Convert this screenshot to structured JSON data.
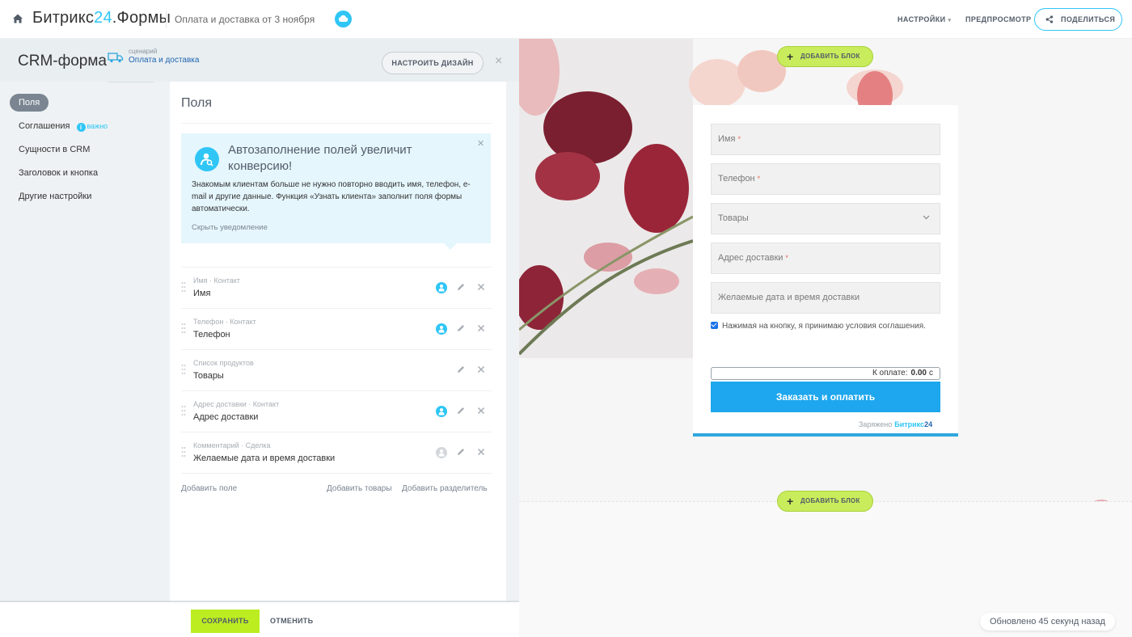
{
  "topbar": {
    "logo_main": "Битрикс",
    "logo_accent": "24",
    "logo_tail": ".Формы",
    "page_title": "Оплата и доставка от 3 ноября",
    "settings_label": "НАСТРОЙКИ",
    "preview_label": "ПРЕДПРОСМОТР",
    "share_label": "ПОДЕЛИТЬСЯ"
  },
  "header": {
    "title": "CRM-форма",
    "scenario_caption": "сценарий",
    "scenario_name": "Оплата и доставка",
    "design_button": "НАСТРОИТЬ ДИЗАЙН"
  },
  "sidebar": {
    "items": [
      {
        "label": "Поля",
        "active": true
      },
      {
        "label": "Соглашения",
        "badge": "важно"
      },
      {
        "label": "Сущности в CRM"
      },
      {
        "label": "Заголовок и кнопка"
      },
      {
        "label": "Другие настройки"
      }
    ]
  },
  "fields_panel": {
    "title": "Поля",
    "banner": {
      "title": "Автозаполнение полей увеличит конверсию!",
      "text": "Знакомым клиентам больше не нужно повторно вводить имя, телефон, e-mail и другие данные. Функция «Узнать клиента» заполнит поля формы автоматически.",
      "hide_link": "Скрыть уведомление"
    },
    "fields": [
      {
        "caption": "Имя · Контакт",
        "name": "Имя",
        "crm": "on"
      },
      {
        "caption": "Телефон · Контакт",
        "name": "Телефон",
        "crm": "on"
      },
      {
        "caption": "Список продуктов",
        "name": "Товары",
        "crm": "none"
      },
      {
        "caption": "Адрес доставки · Контакт",
        "name": "Адрес доставки",
        "crm": "on"
      },
      {
        "caption": "Комментарий · Сделка",
        "name": "Желаемые дата и время доставки",
        "crm": "off"
      }
    ],
    "add_field": "Добавить поле",
    "add_goods": "Добавить товары",
    "add_separator": "Добавить разделитель"
  },
  "footer": {
    "save": "СОХРАНИТЬ",
    "cancel": "ОТМЕНИТЬ"
  },
  "preview": {
    "add_block": "ДОБАВИТЬ БЛОК",
    "form": {
      "inputs": [
        {
          "placeholder": "Имя",
          "required": true
        },
        {
          "placeholder": "Телефон",
          "required": true
        },
        {
          "placeholder": "Товары",
          "select": true
        },
        {
          "placeholder": "Адрес доставки",
          "required": true
        },
        {
          "placeholder": "Желаемые дата и время доставки"
        }
      ],
      "required_mark": "*",
      "agreement": "Нажимая на кнопку, я принимаю условия соглашения.",
      "total_label": "К оплате:",
      "total_value": "0.00",
      "total_currency": "с",
      "order_button": "Заказать и оплатить",
      "powered_by": "Заряжено",
      "powered_brand": "Битрикс",
      "powered_brand_num": "24"
    },
    "updated": "Обновлено 45 секунд назад"
  },
  "colors": {
    "accent": "#2fc6f6",
    "save_button": "#bbed21",
    "order_button": "#1ea7ee"
  }
}
